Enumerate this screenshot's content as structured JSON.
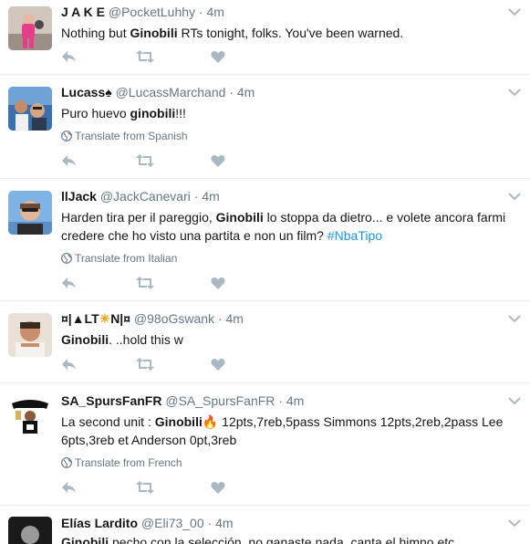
{
  "tweets": [
    {
      "fullname": "J A K E",
      "handle": "@PocketLuhhy",
      "sep": "·",
      "time": "4m",
      "text_before": "Nothing but ",
      "text_bold": "Ginobili",
      "text_after": " RTs tonight, folks.  You've been warned."
    },
    {
      "fullname": "Lucass",
      "name_emoji": "♠",
      "handle": "@LucassMarchand",
      "sep": "·",
      "time": "4m",
      "text_before": "Puro huevo ",
      "text_bold": "ginobili",
      "text_after": "!!!",
      "translate": "Translate from Spanish"
    },
    {
      "fullname": "llJack",
      "handle": "@JackCanevari",
      "sep": "·",
      "time": "4m",
      "text_before": "Harden tira per il pareggio, ",
      "text_bold": "Ginobili",
      "text_after": " lo stoppa da dietro... e volete ancora farmi credere che ho visto una partita e non un film? ",
      "hashtag": "#NbaTipo",
      "translate": "Translate from Italian"
    },
    {
      "fullname_a": "¤|▲LT",
      "name_emoji": "☀",
      "fullname_b": "N|¤",
      "handle": "@98oGswank",
      "sep": "·",
      "time": "4m",
      "text_before": "",
      "text_bold": "Ginobili",
      "text_after": ". ..hold this w"
    },
    {
      "fullname": "SA_SpursFanFR",
      "handle": "@SA_SpursFanFR",
      "sep": "·",
      "time": "4m",
      "text_before": "La second unit : ",
      "text_bold": "Ginobili",
      "fire": "🔥",
      "text_after": " 12pts,7reb,5pass Simmons 12pts,2reb,2pass Lee 6pts,3reb et Anderson 0pt,3reb",
      "translate": "Translate from French"
    },
    {
      "fullname": "Elías Lardito",
      "handle": "@Eli73_00",
      "sep": "·",
      "time": "4m",
      "text_before": "",
      "text_bold": "Ginobili",
      "text_after": " pecho con la selección, no ganaste nada, canta el himno etc"
    }
  ],
  "icons": {
    "reply": "reply-icon",
    "retweet": "retweet-icon",
    "like": "heart-icon",
    "more": "chevron-down-icon",
    "globe": "globe-icon"
  },
  "colors": {
    "text": "#14171a",
    "secondary": "#657786",
    "action": "#aab8c2",
    "link": "#1b95e0",
    "divider": "#e6ecf0"
  }
}
